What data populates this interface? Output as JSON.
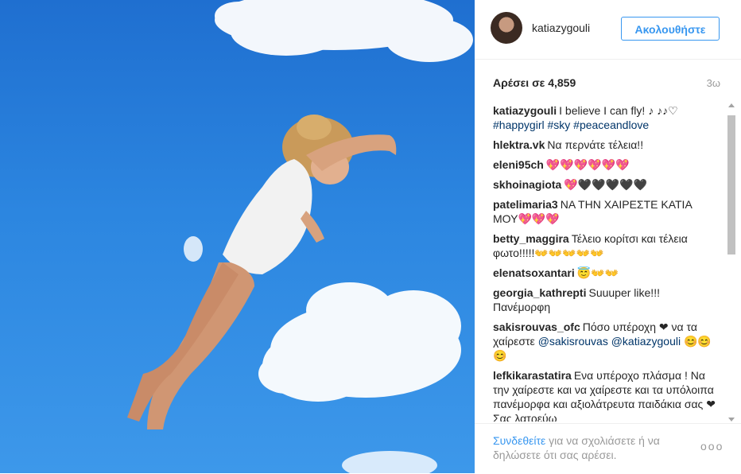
{
  "post": {
    "username": "katiazygouli",
    "follow_label": "Ακολουθήστε",
    "likes_prefix": "Αρέσει σε",
    "likes_count": "4,859",
    "age": "3ω"
  },
  "comments": [
    {
      "user": "katiazygouli",
      "text": "I believe I can fly! ♪ ♪♪♡",
      "tags": "#happygirl #sky #peaceandlove"
    },
    {
      "user": "hlektra.vk",
      "text": "Να περνάτε τέλεια!!"
    },
    {
      "user": "eleni95ch",
      "text": "💖💖💖💖💖💖"
    },
    {
      "user": "skhoinagiota",
      "text": "💖🖤🖤🖤🖤🖤"
    },
    {
      "user": "patelimaria3",
      "text": "ΝΑ ΤΗΝ ΧΑΙΡΕΣΤΕ ΚΑΤΙΑ ΜΟΥ💖💖💖"
    },
    {
      "user": "betty_maggira",
      "text": "Τέλειο κορίτσι και τέλεια φωτο!!!!!👐👐👐👐👐"
    },
    {
      "user": "elenatsoxantari",
      "text": "😇👐👐"
    },
    {
      "user": "georgia_kathrepti",
      "text": "Suuuper like!!! Πανέμορφη"
    },
    {
      "user": "sakisrouvas_ofc",
      "text": "Πόσο υπέροχη ❤ να τα χαίρεστε",
      "tags": "@sakisrouvas @katiazygouli 😊😊😊"
    },
    {
      "user": "lefkikarastatira",
      "text": "Ενα υπέροχο πλάσμα ! Να την χαίρεστε και να χαίρεστε και τα υπόλοιπα πανέμορφα και αξιολάτρευτα παιδάκια σας ❤ Σας λατρεύω"
    }
  ],
  "footer": {
    "login_link": "Συνδεθείτε",
    "login_text": "για να σχολιάσετε ή να δηλώσετε ότι σας αρέσει.",
    "more_label": "ooo"
  },
  "icons": {
    "more": "more-options-icon"
  }
}
